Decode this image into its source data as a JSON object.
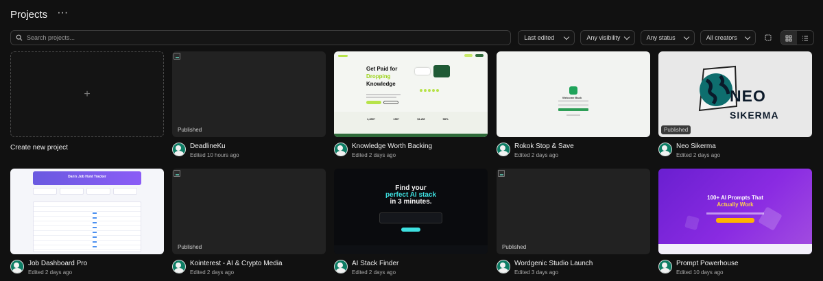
{
  "header": {
    "title": "Projects",
    "more_icon": "more-horizontal-icon"
  },
  "search": {
    "placeholder": "Search projects..."
  },
  "filters": {
    "sort": "Last edited",
    "visibility": "Any visibility",
    "status": "Any status",
    "creators": "All creators"
  },
  "create": {
    "label": "Create new project",
    "icon": "plus-icon"
  },
  "projects": [
    {
      "name": "DeadlineKu",
      "edited": "Edited 10 hours ago",
      "badge": "Published"
    },
    {
      "name": "Knowledge Worth Backing",
      "edited": "Edited 2 days ago",
      "badge": "",
      "preview": {
        "headline1": "Get Paid for",
        "headline2": "Dropping",
        "headline3": "Knowledge",
        "stats": [
          "1,450+",
          "150+",
          "$1.2M",
          "98%"
        ]
      }
    },
    {
      "name": "Rokok Stop & Save",
      "edited": "Edited 2 days ago",
      "badge": "",
      "preview": {
        "heading": "Welcome Back"
      }
    },
    {
      "name": "Neo Sikerma",
      "edited": "Edited 2 days ago",
      "badge": "Published",
      "preview": {
        "logo_line1": "NEO",
        "logo_line2": "SIKERMA"
      }
    },
    {
      "name": "Job Dashboard Pro",
      "edited": "Edited 2 days ago",
      "badge": "",
      "preview": {
        "banner": "Dan's Job Hunt Tracker"
      }
    },
    {
      "name": "Kointerest - AI & Crypto Media",
      "edited": "Edited 2 days ago",
      "badge": "Published"
    },
    {
      "name": "AI Stack Finder",
      "edited": "Edited 2 days ago",
      "badge": "",
      "preview": {
        "line1": "Find your",
        "line2": "perfect AI stack",
        "line3": "in 3 minutes."
      }
    },
    {
      "name": "Wordgenic Studio Launch",
      "edited": "Edited 3 days ago",
      "badge": "Published"
    },
    {
      "name": "Prompt Powerhouse",
      "edited": "Edited 10 days ago",
      "badge": "",
      "preview": {
        "line1": "100+ AI Prompts That",
        "line2": "Actually Work"
      }
    }
  ]
}
